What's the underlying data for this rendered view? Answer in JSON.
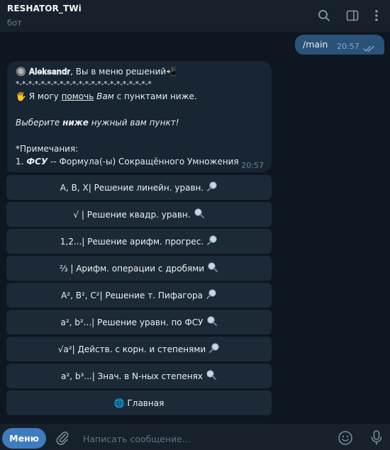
{
  "header": {
    "title": "RESHATOR_TWi",
    "subtitle": "бот"
  },
  "outgoing": {
    "text": "/main",
    "time": "20:57"
  },
  "message": {
    "line1_emoji": "🔘",
    "line1_name": "𝐀𝐥𝐞𝐤𝐬𝐚𝐧𝐝𝐫",
    "line1_rest": ", Вы в меню решений📲",
    "line2": "*-*-*-*-*-*-*-*-*-*-*-*-*-*-*-*-*-*-*-*-*-*",
    "line3_a": "🖐 Я ",
    "line3_b": "могу",
    "line3_c": " ",
    "line3_d": "помочь",
    "line3_e": " ",
    "line3_f": "Вам",
    "line3_g": " с пунктами ниже.",
    "line4_a": "Выберите ",
    "line4_b": "ниже",
    "line4_c": " нужный вам пункт!",
    "line5": "*Примечания:",
    "line6_a": "1. ",
    "line6_b": "ФСУ",
    "line6_c": " -- Формула(-ы) Сокращённого Умножения",
    "time": "20:57"
  },
  "keyboard": [
    {
      "label": "A, B, X| Решение линейн. уравн.",
      "icon": "magnifier-left-icon"
    },
    {
      "label": "√ | Решение квадр. уравн.",
      "icon": "magnifier-right-icon"
    },
    {
      "label": "1,2...| Решение арифм. прогрес.",
      "icon": "magnifier-left-icon"
    },
    {
      "label": "⅔ | Арифм. операции с дробями",
      "icon": "magnifier-right-icon"
    },
    {
      "label": "A², B², C²| Решение т. Пифагора",
      "icon": "magnifier-left-icon"
    },
    {
      "label": "a², b²...| Решение уравн. по ФСУ",
      "icon": "magnifier-right-icon"
    },
    {
      "label": "√a²| Действ. с корн. и степенями",
      "icon": "magnifier-left-icon"
    },
    {
      "label": "a², b³...| Знач. в N-ных степенях",
      "icon": "magnifier-right-icon"
    },
    {
      "label": "🌐 Главная",
      "icon": "globe-icon"
    }
  ],
  "composer": {
    "menu_label": "Меню",
    "placeholder": "Написать сообщение..."
  },
  "colors": {
    "background": "#0e1621",
    "header": "#17212b",
    "outgoing_bubble": "#2b5278",
    "incoming_bubble": "#182533",
    "keyboard_button": "#1c2a38",
    "menu_button": "#3e7cbe"
  },
  "icons": [
    "search-icon",
    "sidebar-toggle-icon",
    "more-vert-icon",
    "double-check-icon",
    "paperclip-icon",
    "emoji-icon",
    "microphone-icon"
  ]
}
